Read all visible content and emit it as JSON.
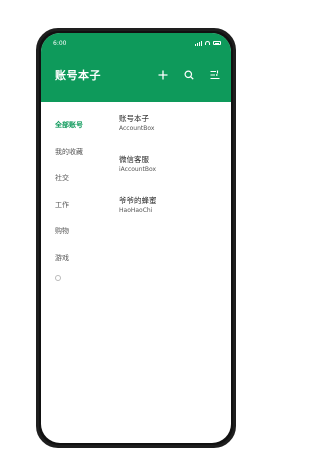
{
  "status": {
    "time": "6:00"
  },
  "header": {
    "title": "账号本子"
  },
  "sidebar": {
    "items": [
      {
        "label": "全部账号",
        "active": true
      },
      {
        "label": "我的收藏",
        "active": false
      },
      {
        "label": "社交",
        "active": false
      },
      {
        "label": "工作",
        "active": false
      },
      {
        "label": "购物",
        "active": false
      },
      {
        "label": "游戏",
        "active": false
      }
    ]
  },
  "accounts": [
    {
      "name": "账号本子",
      "account": "AccountBox"
    },
    {
      "name": "微信客服",
      "account": "iAccountBox"
    },
    {
      "name": "爷爷的蜂蜜",
      "account": "HaoHaoChi"
    }
  ],
  "colors": {
    "brand": "#0e9a5b"
  },
  "icons": [
    "add-icon",
    "search-icon",
    "filter-list-icon",
    "circle-icon"
  ]
}
